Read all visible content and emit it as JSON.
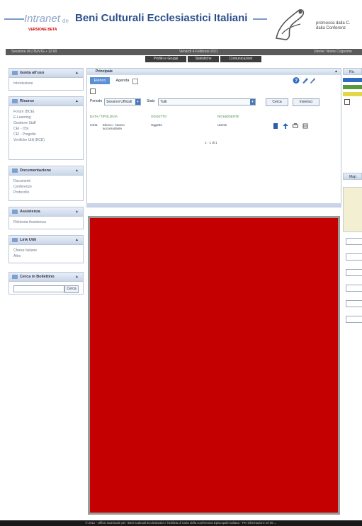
{
  "header": {
    "brand_left": "Intranet",
    "brand_de": "de",
    "brand_main": "Beni Culturali Ecclesiastici Italiani",
    "version": "VERSIONE BETA",
    "promo": "promossa dalla C.\ndalla Conferenz"
  },
  "topbar": {
    "session": "Sessione di UTENTE • 12:00",
    "date": "Venerdì 4 Febbraio 2011",
    "user": "Utente: Nome Cognome"
  },
  "nav": [
    "Profilo e Gruppi",
    "Statistiche",
    "Comunicazioni"
  ],
  "sidebar": {
    "boxes": [
      {
        "title": "Guida all'uso",
        "items": [
          "Introduzione"
        ]
      },
      {
        "title": "Risorse",
        "items": [
          "Forum (BCE)",
          "E-Learning",
          "Gestione Staff",
          "CEI - OSI",
          "CEI - Progetto",
          "Verifiche Utili (BCE)"
        ]
      },
      {
        "title": "Documentazione",
        "items": [
          "Documenti",
          "Conferenze",
          "Protocollo"
        ]
      },
      {
        "title": "Assistenza",
        "items": [
          "Richiesta Assistenza"
        ]
      },
      {
        "title": "Link Utili",
        "items": [
          "Chiese Italiane",
          "Altro"
        ]
      },
      {
        "title": "Cerca in Bollettino",
        "items": []
      }
    ],
    "search_button": "Cerca"
  },
  "center": {
    "title": "Principale",
    "tabs": [
      {
        "label": "Elenco",
        "active": true
      },
      {
        "label": "Agenda",
        "active": false
      }
    ],
    "filter_label": "Periodo",
    "filter_period": "Sessioni Ufficiali",
    "filter_label2": "Stato",
    "filter_status": "Tutti",
    "btn_cerca": "Cerca",
    "btn_inserisci": "Inserisci",
    "columns": [
      "DATA / TIPOLOGIA",
      "OGGETTO",
      "RICHIEDENTE"
    ],
    "rows": [
      {
        "date": "24/11",
        "type": "Elenco - Nuovo accomodante",
        "object": "Oggetto",
        "requester": "Utente"
      }
    ],
    "pager": "1 - 1 di 1"
  },
  "right": {
    "labels": [
      "Ric",
      "Map"
    ]
  },
  "footer": "© 2011 - Ufficio Nazionale per i Beni Culturali Ecclesiastici e l'Edilizia di Culto della Conferenza Episcopale Italiana - Per informazioni: tel 06 ..."
}
